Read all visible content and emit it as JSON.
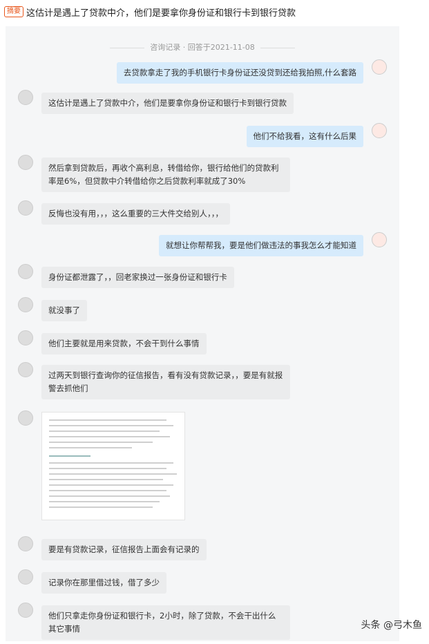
{
  "summary": {
    "badge": "摘要",
    "title": "这估计是遇上了贷款中介，他们是要拿你身份证和银行卡到银行贷款"
  },
  "record": "咨询记录 · 回答于2021-11-08",
  "messages": [
    {
      "side": "right",
      "text": "去贷款拿走了我的手机银行卡身份证还没贷到还给我拍照,什么套路"
    },
    {
      "side": "left",
      "text": "这估计是遇上了贷款中介，他们是要拿你身份证和银行卡到银行贷款"
    },
    {
      "side": "right",
      "text": "他们不给我看，这有什么后果"
    },
    {
      "side": "left",
      "text": "然后拿到贷款后，再收个高利息，转借给你，银行给他们的贷款利率是6%，但贷款中介转借给你之后贷款利率就成了30%"
    },
    {
      "side": "left",
      "text": "反悔也没有用，，，这么重要的三大件交给别人，，，"
    },
    {
      "side": "right",
      "text": "就想让你帮帮我，要是他们做违法的事我怎么才能知道"
    },
    {
      "side": "left",
      "text": "身份证都泄露了，，回老家换过一张身份证和银行卡"
    },
    {
      "side": "left",
      "text": "就没事了"
    },
    {
      "side": "left",
      "text": "他们主要就是用来贷款，不会干到什么事情"
    },
    {
      "side": "left",
      "text": "过两天到银行查询你的征信报告，看有没有贷款记录，，要是有就报警去抓他们"
    },
    {
      "side": "left",
      "text": ""
    },
    {
      "side": "left",
      "text": "要是有贷款记录，征信报告上面会有记录的"
    },
    {
      "side": "left",
      "text": "记录你在那里借过钱，借了多少"
    },
    {
      "side": "left",
      "text": "他们只拿走你身份证和银行卡，2小时，除了贷款，不会干出什么其它事情"
    }
  ],
  "watermark": "头条 @弓木鱼"
}
